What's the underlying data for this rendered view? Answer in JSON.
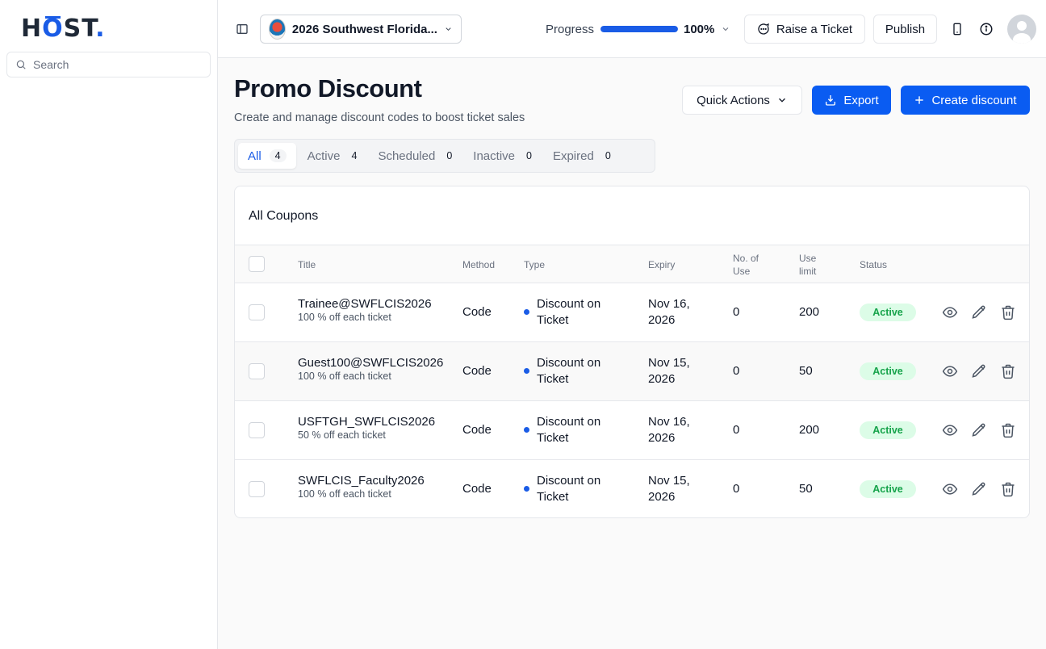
{
  "app": {
    "logo_text": "HŌST.",
    "search_placeholder": "Search"
  },
  "header": {
    "event_name": "2026 Southwest Florida...",
    "progress_label": "Progress",
    "progress_value": 100,
    "progress_text": "100%",
    "raise_ticket_label": "Raise a Ticket",
    "publish_label": "Publish"
  },
  "page": {
    "title": "Promo Discount",
    "subtitle": "Create and manage discount codes to boost ticket sales",
    "quick_actions_label": "Quick Actions",
    "export_label": "Export",
    "create_label": "Create discount"
  },
  "tabs": [
    {
      "label": "All",
      "count": "4",
      "active": true
    },
    {
      "label": "Active",
      "count": "4",
      "active": false
    },
    {
      "label": "Scheduled",
      "count": "0",
      "active": false
    },
    {
      "label": "Inactive",
      "count": "0",
      "active": false
    },
    {
      "label": "Expired",
      "count": "0",
      "active": false
    }
  ],
  "table": {
    "title": "All Coupons",
    "headers": {
      "title": "Title",
      "method": "Method",
      "type": "Type",
      "expiry": "Expiry",
      "uses_line1": "No. of",
      "uses_line2": "Use",
      "limit_line1": "Use",
      "limit_line2": "limit",
      "status": "Status"
    },
    "rows": [
      {
        "name": "Trainee@SWFLCIS2026",
        "desc": "100 % off each ticket",
        "method": "Code",
        "type_line1": "Discount on",
        "type_line2": "Ticket",
        "expiry_line1": "Nov 16,",
        "expiry_line2": "2026",
        "uses": "0",
        "limit": "200",
        "status": "Active"
      },
      {
        "name": "Guest100@SWFLCIS2026",
        "desc": "100 % off each ticket",
        "method": "Code",
        "type_line1": "Discount on",
        "type_line2": "Ticket",
        "expiry_line1": "Nov 15,",
        "expiry_line2": "2026",
        "uses": "0",
        "limit": "50",
        "status": "Active"
      },
      {
        "name": "USFTGH_SWFLCIS2026",
        "desc": "50 % off each ticket",
        "method": "Code",
        "type_line1": "Discount on",
        "type_line2": "Ticket",
        "expiry_line1": "Nov 16,",
        "expiry_line2": "2026",
        "uses": "0",
        "limit": "200",
        "status": "Active"
      },
      {
        "name": "SWFLCIS_Faculty2026",
        "desc": "100 % off each ticket",
        "method": "Code",
        "type_line1": "Discount on",
        "type_line2": "Ticket",
        "expiry_line1": "Nov 15,",
        "expiry_line2": "2026",
        "uses": "0",
        "limit": "50",
        "status": "Active"
      }
    ]
  },
  "colors": {
    "accent": "#0a5cf2",
    "status_active_bg": "#dcfce7",
    "status_active_text": "#16a34a"
  }
}
